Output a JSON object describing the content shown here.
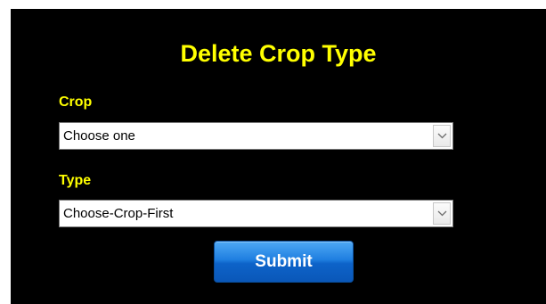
{
  "form": {
    "title": "Delete Crop Type",
    "crop": {
      "label": "Crop",
      "selected": "Choose one"
    },
    "type": {
      "label": "Type",
      "selected": "Choose-Crop-First"
    },
    "submit_label": "Submit"
  },
  "icons": {
    "dropdown": "chevron-down-icon"
  },
  "colors": {
    "background": "#000000",
    "label": "#ffff00",
    "button": "#1f7fe0",
    "button_text": "#ffffff"
  }
}
